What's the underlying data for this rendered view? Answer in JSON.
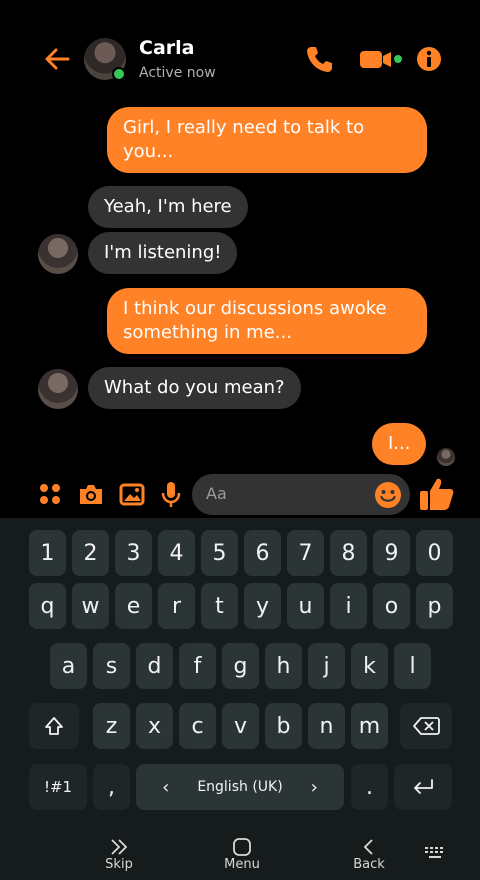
{
  "header": {
    "contact_name": "Carla",
    "status": "Active now",
    "icons": [
      "back-arrow-icon",
      "phone-icon",
      "video-icon",
      "info-icon"
    ]
  },
  "messages": [
    {
      "from": "me",
      "text": "Girl, I really need to talk to you..."
    },
    {
      "from": "them",
      "text": "Yeah, I'm here"
    },
    {
      "from": "them",
      "text": "I'm listening!"
    },
    {
      "from": "me",
      "text": "I think our discussions awoke something in me..."
    },
    {
      "from": "them",
      "text": "What do you mean?"
    },
    {
      "from": "me",
      "text": "I..."
    }
  ],
  "composer": {
    "placeholder": "Aa",
    "icons": [
      "apps-icon",
      "camera-icon",
      "gallery-icon",
      "mic-icon",
      "emoji-icon",
      "thumbs-up-icon"
    ]
  },
  "keyboard": {
    "row_numbers": [
      "1",
      "2",
      "3",
      "4",
      "5",
      "6",
      "7",
      "8",
      "9",
      "0"
    ],
    "row_top": [
      "q",
      "w",
      "e",
      "r",
      "t",
      "y",
      "u",
      "i",
      "o",
      "p"
    ],
    "row_mid": [
      "a",
      "s",
      "d",
      "f",
      "g",
      "h",
      "j",
      "k",
      "l"
    ],
    "row_bottom": [
      "z",
      "x",
      "c",
      "v",
      "b",
      "n",
      "m"
    ],
    "symbols_key": "!#1",
    "comma_key": ",",
    "language": "English (UK)",
    "period_key": ".",
    "lang_left": "‹",
    "lang_right": "›"
  },
  "navbar": {
    "skip": "Skip",
    "menu": "Menu",
    "back": "Back"
  },
  "colors": {
    "accent": "#ff8226",
    "background": "#000000",
    "received_bubble": "#333333",
    "keyboard_bg": "#161b1c",
    "key_bg": "#2c3536",
    "online": "#35c759"
  }
}
